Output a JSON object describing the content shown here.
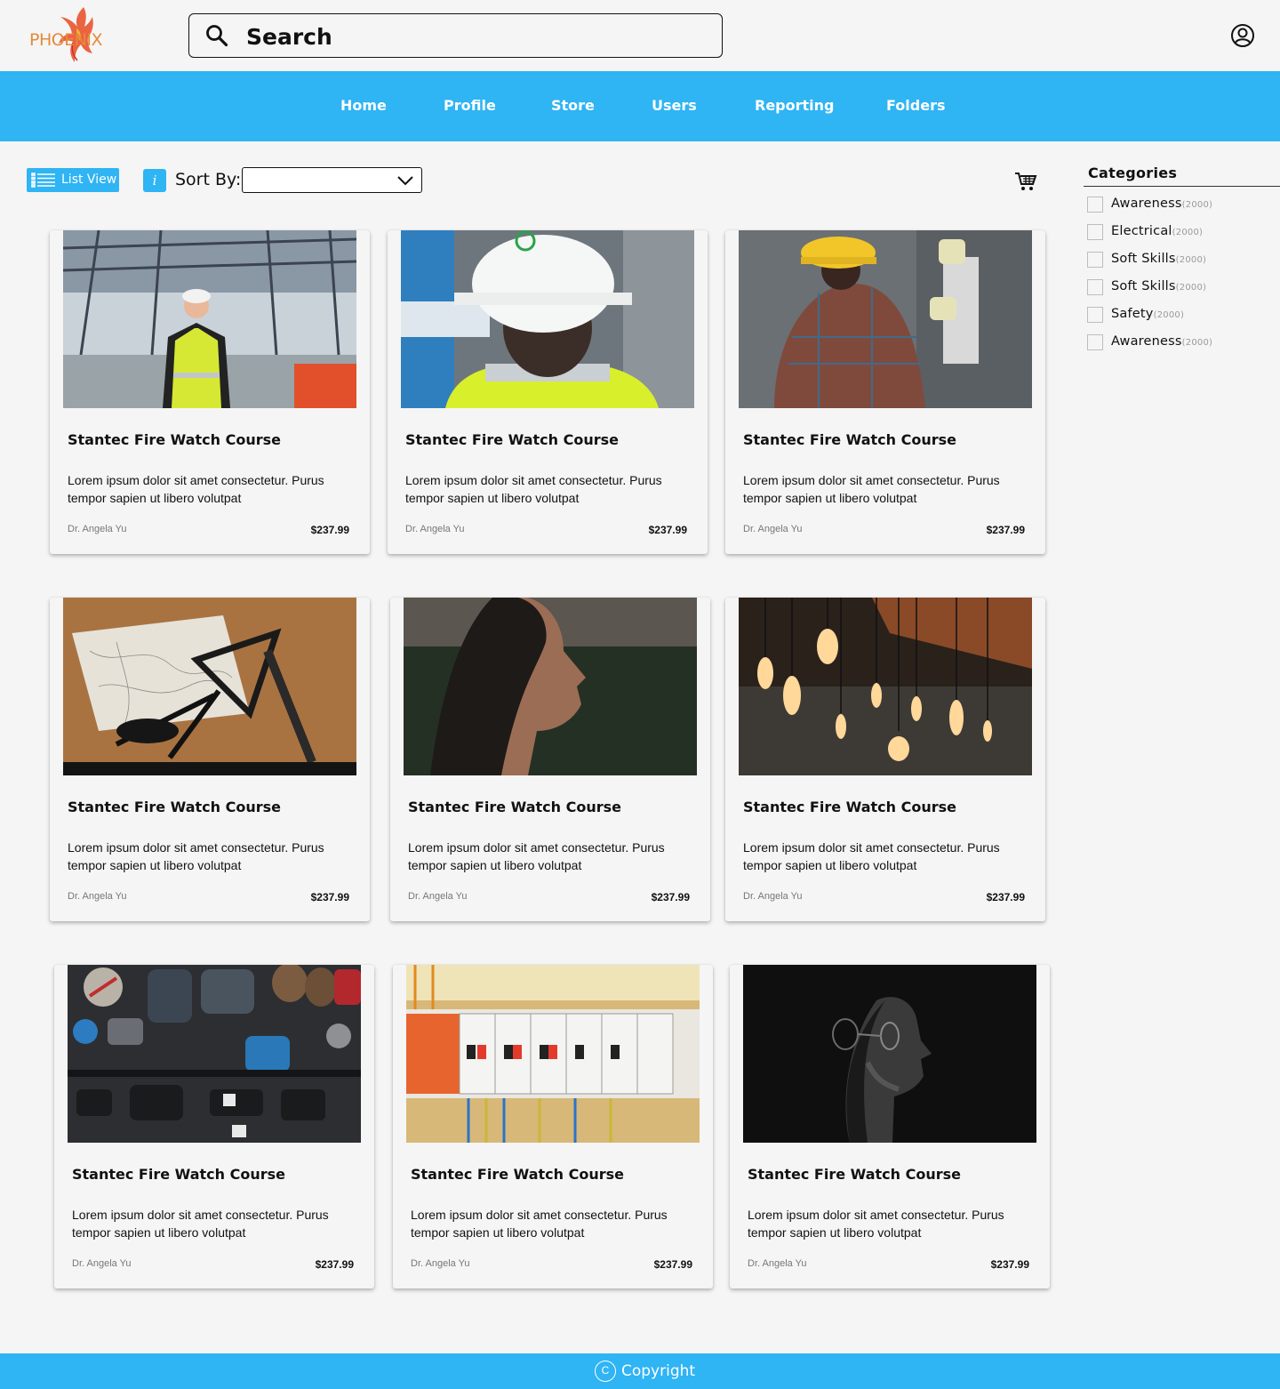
{
  "header": {
    "logo_text": "PHOENIX",
    "search_placeholder": "Search"
  },
  "nav": {
    "items": [
      {
        "label": "Home"
      },
      {
        "label": "Profile"
      },
      {
        "label": "Store"
      },
      {
        "label": "Users"
      },
      {
        "label": "Reporting"
      },
      {
        "label": "Folders"
      }
    ]
  },
  "toolbar": {
    "list_view_label": "List View",
    "info_label": "i",
    "sort_label": "Sort By:",
    "sort_value": ""
  },
  "categories": {
    "title": "Categories",
    "items": [
      {
        "name": "Awareness",
        "count": "(2000)"
      },
      {
        "name": "Electrical",
        "count": "(2000)"
      },
      {
        "name": "Soft Skills",
        "count": "(2000)"
      },
      {
        "name": "Soft Skills",
        "count": "(2000)"
      },
      {
        "name": "Safety",
        "count": "(2000)"
      },
      {
        "name": "Awareness",
        "count": "(2000)"
      }
    ]
  },
  "courses": [
    {
      "title": "Stantec Fire Watch Course",
      "description": "Lorem ipsum dolor sit amet consectetur. Purus tempor sapien ut libero volutpat",
      "author": "Dr. Angela Yu",
      "price": "$237.99",
      "image": "construction-worker-site"
    },
    {
      "title": "Stantec Fire Watch Course",
      "description": "Lorem ipsum dolor sit amet consectetur. Purus tempor sapien ut libero volutpat",
      "author": "Dr. Angela Yu",
      "price": "$237.99",
      "image": "worker-hard-hat-back"
    },
    {
      "title": "Stantec Fire Watch Course",
      "description": "Lorem ipsum dolor sit amet consectetur. Purus tempor sapien ut libero volutpat",
      "author": "Dr. Angela Yu",
      "price": "$237.99",
      "image": "electrician-panel"
    },
    {
      "title": "Stantec Fire Watch Course",
      "description": "Lorem ipsum dolor sit amet consectetur. Purus tempor sapien ut libero volutpat",
      "author": "Dr. Angela Yu",
      "price": "$237.99",
      "image": "drafting-tools"
    },
    {
      "title": "Stantec Fire Watch Course",
      "description": "Lorem ipsum dolor sit amet consectetur. Purus tempor sapien ut libero volutpat",
      "author": "Dr. Angela Yu",
      "price": "$237.99",
      "image": "man-profile-dusk"
    },
    {
      "title": "Stantec Fire Watch Course",
      "description": "Lorem ipsum dolor sit amet consectetur. Purus tempor sapien ut libero volutpat",
      "author": "Dr. Angela Yu",
      "price": "$237.99",
      "image": "hanging-bulbs"
    },
    {
      "title": "Stantec Fire Watch Course",
      "description": "Lorem ipsum dolor sit amet consectetur. Purus tempor sapien ut libero volutpat",
      "author": "Dr. Angela Yu",
      "price": "$237.99",
      "image": "camera-gear-flatlay"
    },
    {
      "title": "Stantec Fire Watch Course",
      "description": "Lorem ipsum dolor sit amet consectetur. Purus tempor sapien ut libero volutpat",
      "author": "Dr. Angela Yu",
      "price": "$237.99",
      "image": "circuit-breakers"
    },
    {
      "title": "Stantec Fire Watch Course",
      "description": "Lorem ipsum dolor sit amet consectetur. Purus tempor sapien ut libero volutpat",
      "author": "Dr. Angela Yu",
      "price": "$237.99",
      "image": "man-glasses-dark"
    }
  ],
  "footer": {
    "copyright_symbol": "C",
    "copyright_label": "Copyright"
  },
  "colors": {
    "accent": "#2fb4f4",
    "background": "#f5f5f5",
    "logo": "#e58a3a"
  }
}
